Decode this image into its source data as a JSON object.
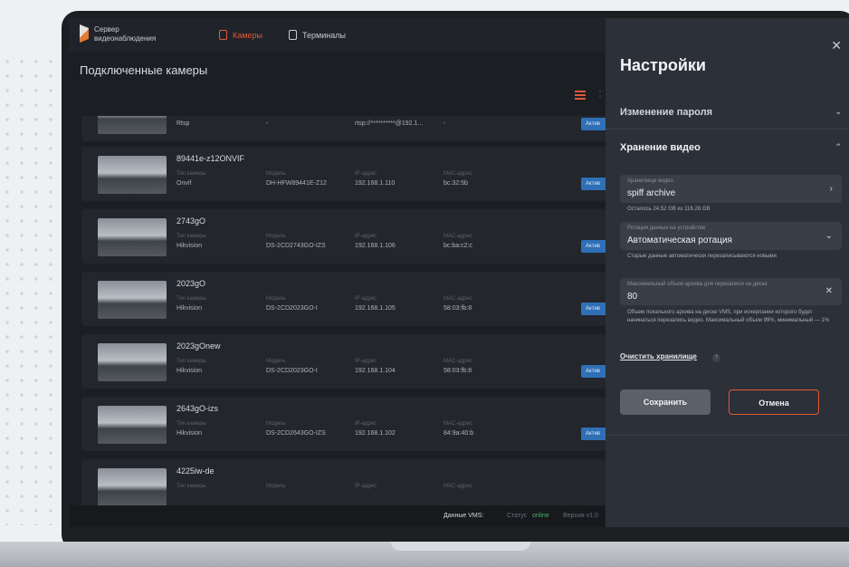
{
  "app": {
    "brand_line1": "Сервер",
    "brand_line2": "видеонаблюдения",
    "tabs": [
      {
        "label": "Камеры",
        "active": true
      },
      {
        "label": "Терминалы",
        "active": false
      }
    ],
    "page_title": "Подключенные камеры"
  },
  "cameras": [
    {
      "name": "",
      "type": "Rtsp",
      "model": "-",
      "ip": "rtsp://**********@192.1...",
      "mac": "-",
      "status": "Актив"
    },
    {
      "name": "89441e-z12ONVIF",
      "type": "Onvif",
      "model": "DH-HFW89441E-Z12",
      "ip": "192.168.1.110",
      "mac": "bc:32:5b",
      "status": "Актив"
    },
    {
      "name": "2743gO",
      "type": "Hikvision",
      "model": "DS-2CD2743GO-IZS",
      "ip": "192.168.1.106",
      "mac": "bc:ba:c2:c",
      "status": "Актив"
    },
    {
      "name": "2023gO",
      "type": "Hikvision",
      "model": "DS-2CD2023GO-I",
      "ip": "192.168.1.105",
      "mac": "58:03:fb:8",
      "status": "Актив"
    },
    {
      "name": "2023gOnew",
      "type": "Hikvision",
      "model": "DS-2CD2023GO-I",
      "ip": "192.168.1.104",
      "mac": "58:03:fb:8",
      "status": "Актив"
    },
    {
      "name": "2643gO-izs",
      "type": "Hikvision",
      "model": "DS-2CD2643GO-IZS",
      "ip": "192.168.1.102",
      "mac": "84:9a:40:b",
      "status": "Актив"
    },
    {
      "name": "4225iw-de",
      "type": "",
      "model": "",
      "ip": "",
      "mac": "",
      "status": ""
    }
  ],
  "field_labels": {
    "type": "Тип камеры",
    "model": "Модель",
    "ip": "IP-адрес",
    "mac": "MAC-адрес"
  },
  "footer": {
    "label": "Данные VMS:",
    "status_label": "Статус",
    "status_value": "online",
    "version_label": "Версия v1.0"
  },
  "settings": {
    "title": "Настройки",
    "section_password": "Изменение пароля",
    "section_storage": "Хранение видео",
    "storage_field_label": "Хранилище видео",
    "storage_field_value": "spiff archive",
    "storage_hint": "Осталось 24.52 GB из 116.28 GB",
    "rotation_label": "Ротация данных на устройстве",
    "rotation_value": "Автоматическая ротация",
    "rotation_hint": "Старые данные автоматически перезаписываются новыми",
    "max_archive_label": "Максимальный объем архива для перезаписи на диске",
    "max_archive_value": "80",
    "max_archive_hint": "Объем локального архива на диске VMS, при исчерпании которого будет начинаться перезапись видео. Максимальный объем 99%, минимальный — 1%",
    "clear_storage": "Очистить хранилище",
    "help": "?",
    "save": "Сохранить",
    "cancel": "Отмена"
  },
  "colors": {
    "accent": "#e3582f",
    "badge": "#2f6fb6",
    "panel": "#2c3038"
  }
}
